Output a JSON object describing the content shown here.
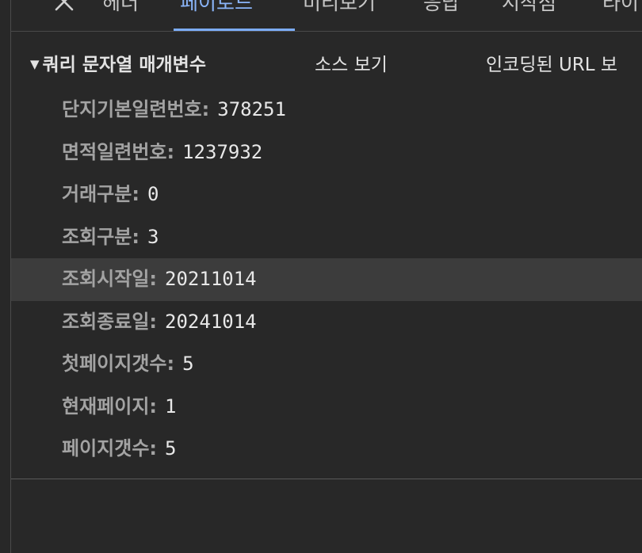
{
  "tabs": [
    {
      "label": "헤더"
    },
    {
      "label": "페이로드"
    },
    {
      "label": "미리보기"
    },
    {
      "label": "응답"
    },
    {
      "label": "시작점"
    },
    {
      "label": "타이"
    }
  ],
  "active_tab": "페이로드",
  "section": {
    "title": "쿼리 문자열 매개변수",
    "view_source_label": "소스 보기",
    "view_url_label": "인코딩된 URL 보"
  },
  "params": [
    {
      "key": "단지기본일련번호",
      "value": "378251"
    },
    {
      "key": "면적일련번호",
      "value": "1237932"
    },
    {
      "key": "거래구분",
      "value": "0"
    },
    {
      "key": "조회구분",
      "value": "3"
    },
    {
      "key": "조회시작일",
      "value": "20211014"
    },
    {
      "key": "조회종료일",
      "value": "20241014"
    },
    {
      "key": "첫페이지갯수",
      "value": "5"
    },
    {
      "key": "현재페이지",
      "value": "1"
    },
    {
      "key": "페이지갯수",
      "value": "5"
    }
  ],
  "colors": {
    "background": "#282828",
    "active_tab": "#8ab4f8",
    "key_text": "#a3a3a3",
    "value_text": "#e8e8e8",
    "hover_row": "#3c3c3c"
  }
}
